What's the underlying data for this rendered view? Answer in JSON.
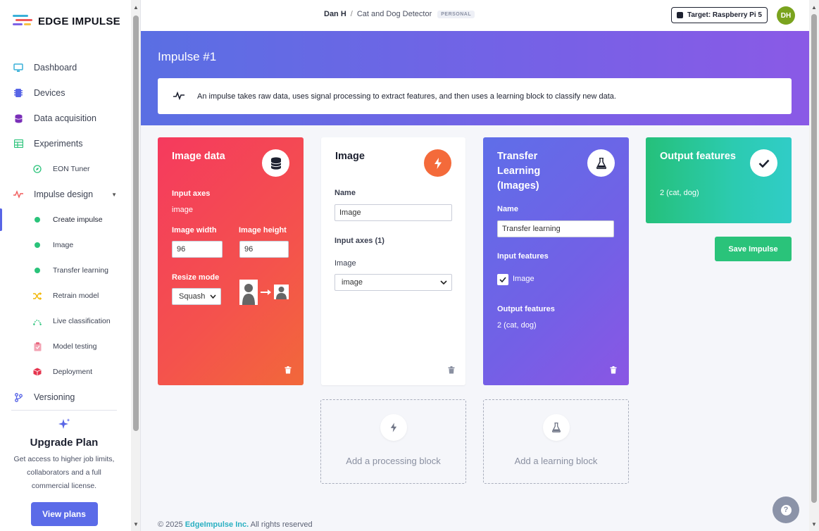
{
  "brand": {
    "name": "EDGE IMPULSE"
  },
  "sidebar": {
    "items": [
      {
        "label": "Dashboard",
        "icon": "monitor-icon"
      },
      {
        "label": "Devices",
        "icon": "chip-icon"
      },
      {
        "label": "Data acquisition",
        "icon": "database-icon"
      },
      {
        "label": "Experiments",
        "icon": "grid-icon"
      },
      {
        "label": "EON Tuner",
        "icon": "compass-icon"
      },
      {
        "label": "Impulse design",
        "icon": "pulse-icon"
      },
      {
        "label": "Create impulse",
        "icon": "dot-icon"
      },
      {
        "label": "Image",
        "icon": "dot-icon"
      },
      {
        "label": "Transfer learning",
        "icon": "dot-icon"
      },
      {
        "label": "Retrain model",
        "icon": "shuffle-icon"
      },
      {
        "label": "Live classification",
        "icon": "antenna-icon"
      },
      {
        "label": "Model testing",
        "icon": "clipboard-icon"
      },
      {
        "label": "Deployment",
        "icon": "box-icon"
      },
      {
        "label": "Versioning",
        "icon": "branch-icon"
      }
    ],
    "upgrade": {
      "title": "Upgrade Plan",
      "text": "Get access to higher job limits, collaborators and a full commercial license.",
      "button": "View plans"
    }
  },
  "header": {
    "user": "Dan H",
    "separator": "/",
    "project": "Cat and Dog Detector",
    "badge": "PERSONAL",
    "target": "Target: Raspberry Pi 5",
    "avatar": "DH"
  },
  "hero": {
    "title": "Impulse #1",
    "info": "An impulse takes raw data, uses signal processing to extract features, and then uses a learning block to classify new data."
  },
  "blocks": {
    "input": {
      "title": "Image data",
      "axes_label": "Input axes",
      "axes_value": "image",
      "width_label": "Image width",
      "width_value": "96",
      "height_label": "Image height",
      "height_value": "96",
      "resize_label": "Resize mode",
      "resize_value": "Squash"
    },
    "processing": {
      "title": "Image",
      "name_label": "Name",
      "name_value": "Image",
      "axes_label": "Input axes (1)",
      "axis_name": "Image",
      "axis_select": "image"
    },
    "learning": {
      "title": "Transfer Learning (Images)",
      "name_label": "Name",
      "name_value": "Transfer learning",
      "input_label": "Input features",
      "input_item": "Image",
      "output_label": "Output features",
      "output_value": "2 (cat, dog)"
    },
    "output": {
      "title": "Output features",
      "value": "2 (cat, dog)"
    }
  },
  "actions": {
    "save": "Save Impulse",
    "add_processing": "Add a processing block",
    "add_learning": "Add a learning block"
  },
  "footer": {
    "copy": "© 2025",
    "company": "EdgeImpulse Inc.",
    "rights": "All rights reserved"
  },
  "colors": {
    "accent": "#5b6be8",
    "green": "#2ac37a",
    "input_block": "#f53a5e",
    "learning_block": "#7360e6"
  }
}
